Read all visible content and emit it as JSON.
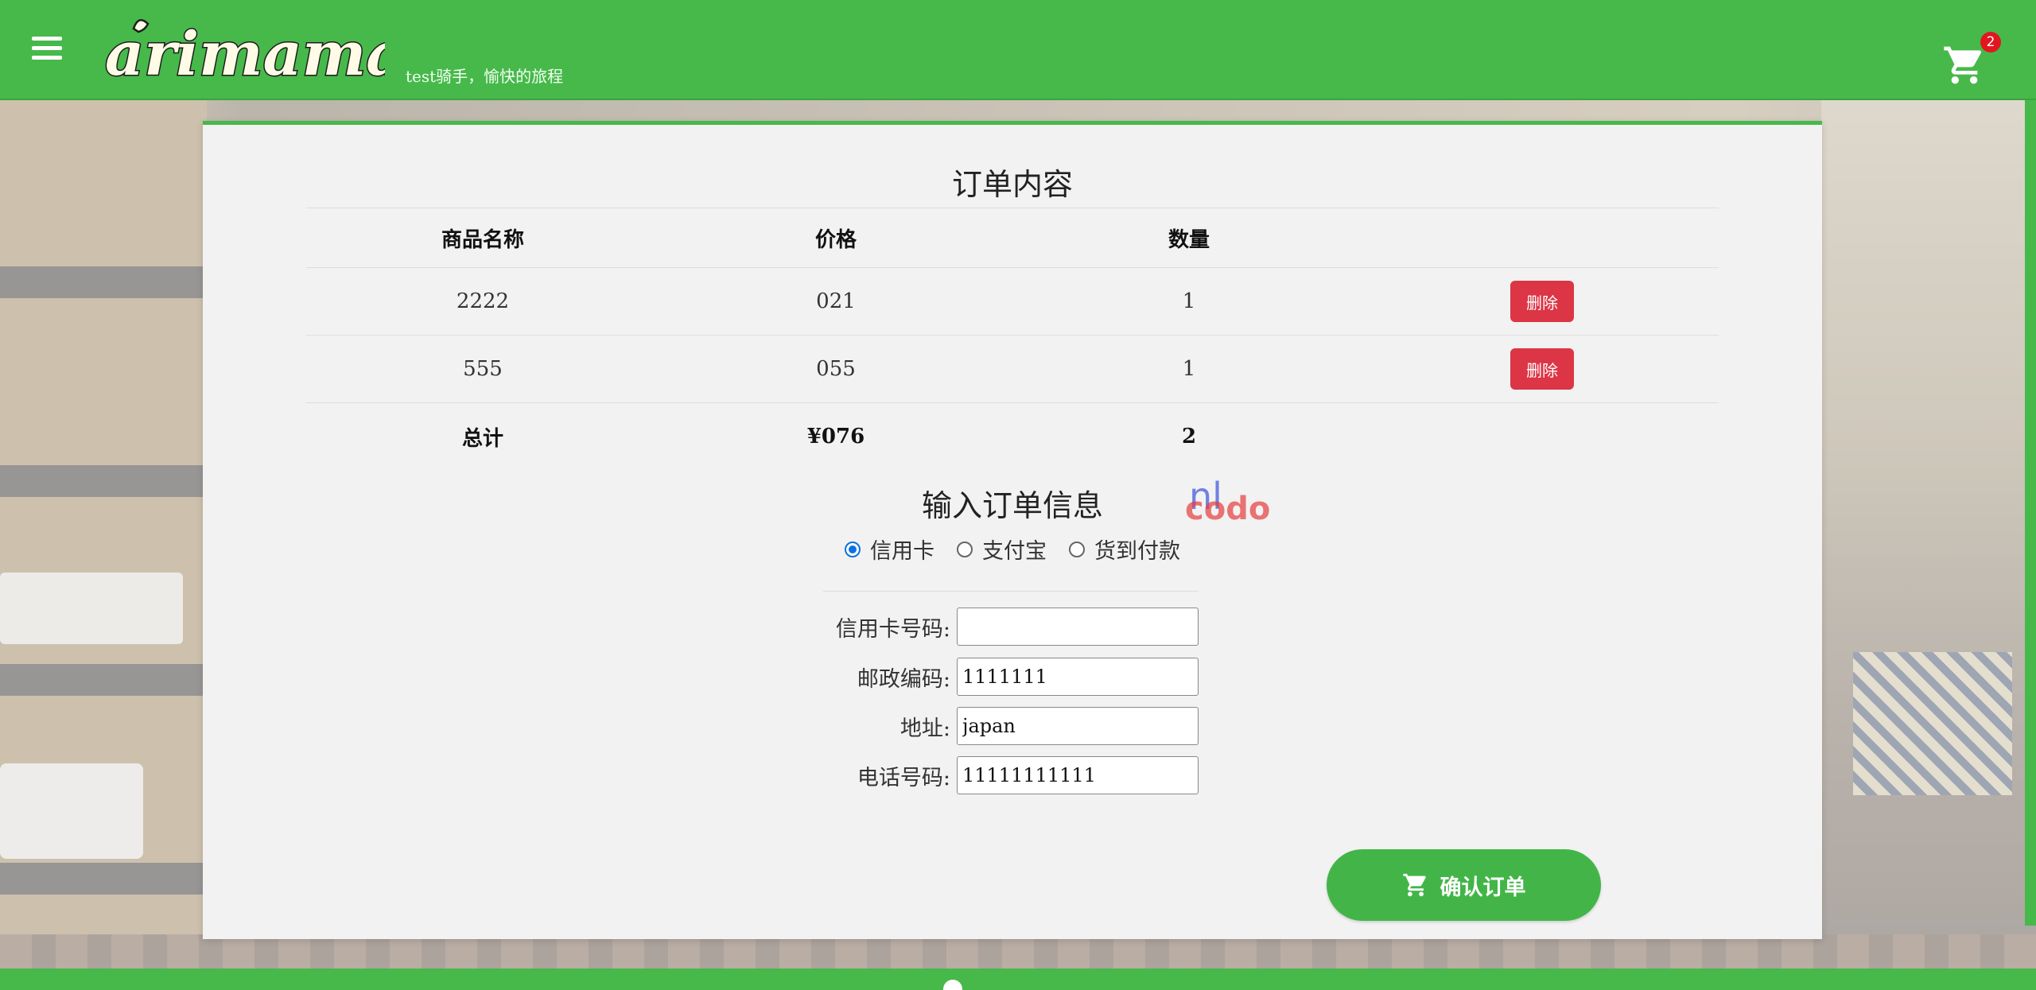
{
  "header": {
    "tagline": "test骑手，愉快的旅程",
    "logo_text": "arimama",
    "cart_count": "2",
    "menu_icon": "hamburger-menu-icon",
    "cart_icon": "shopping-cart-icon"
  },
  "order": {
    "title": "订单内容",
    "columns": [
      "商品名称",
      "价格",
      "数量"
    ],
    "items": [
      {
        "name": "2222",
        "price": "021",
        "qty": "1",
        "delete_label": "删除"
      },
      {
        "name": "555",
        "price": "055",
        "qty": "1",
        "delete_label": "删除"
      }
    ],
    "total": {
      "label": "总计",
      "price": "¥076",
      "qty": "2"
    }
  },
  "info": {
    "title": "输入订单信息",
    "payment_options": [
      {
        "label": "信用卡",
        "selected": true
      },
      {
        "label": "支付宝",
        "selected": false
      },
      {
        "label": "货到付款",
        "selected": false
      }
    ],
    "fields": [
      {
        "label": "信用卡号码:",
        "value": ""
      },
      {
        "label": "邮政编码:",
        "value": "1111111"
      },
      {
        "label": "地址:",
        "value": "japan"
      },
      {
        "label": "电话号码:",
        "value": "11111111111"
      }
    ],
    "confirm_label": "确认订单"
  },
  "watermark": {
    "line1": "nl",
    "line2": "codo"
  },
  "colors": {
    "brand_green": "#46b94a",
    "delete_red": "#dc3545",
    "radio_blue": "#0b72e0",
    "badge_red": "#e0171f"
  }
}
